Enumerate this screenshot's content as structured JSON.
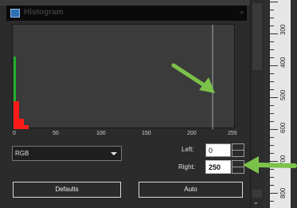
{
  "panel": {
    "title": "Histogram",
    "title_button": "»"
  },
  "histogram": {
    "x_ticks": [
      "0",
      "50",
      "100",
      "150",
      "200",
      "255"
    ],
    "right_marker_value": 231,
    "colors": {
      "red": "#ff1a1a",
      "green": "#1fb02a",
      "blue": "#2255ff",
      "marker": "#a8a8a8"
    }
  },
  "controls": {
    "channel_select": "RGB",
    "left_label": "Left:",
    "left_value": "0",
    "right_label": "Right:",
    "right_value": "250",
    "defaults_button": "Defaults",
    "auto_button": "Auto"
  },
  "ruler": {
    "labels": [
      "300",
      "400",
      "500",
      "600",
      "700",
      "800"
    ]
  },
  "annotations": {
    "arrow_color": "#7cc24a"
  }
}
